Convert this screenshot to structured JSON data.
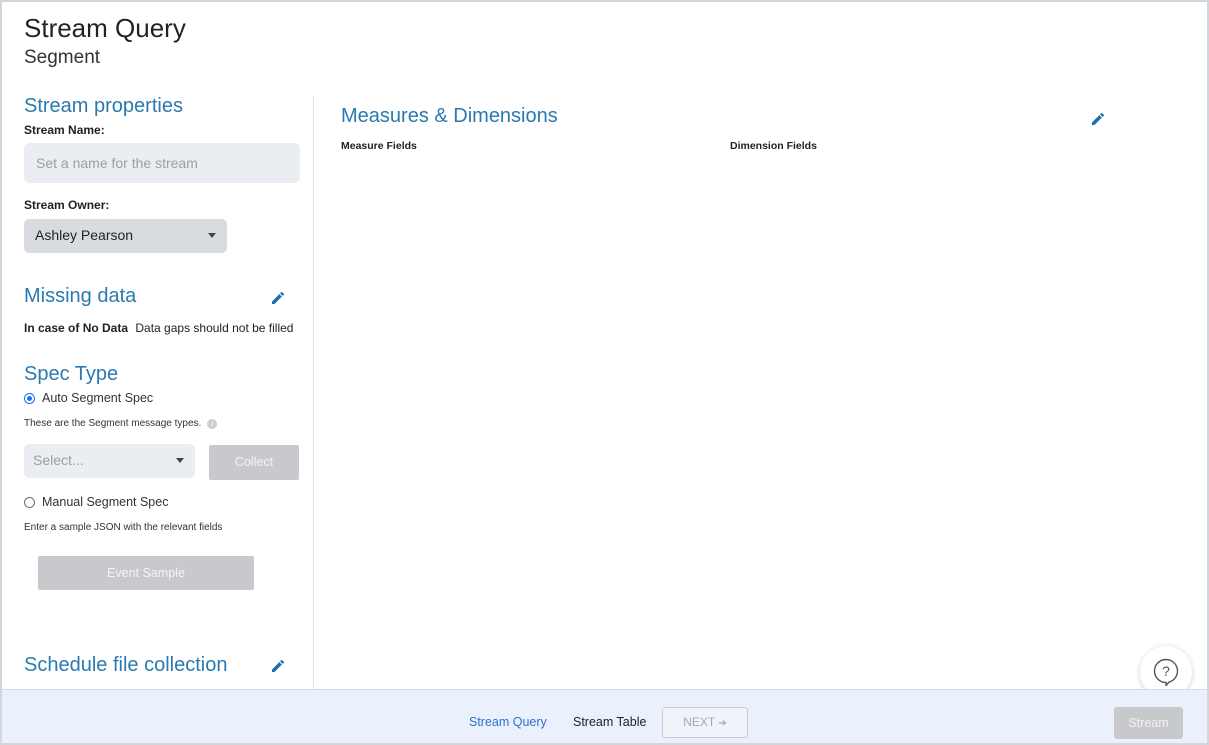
{
  "header": {
    "title": "Stream Query",
    "subtitle": "Segment"
  },
  "stream_properties": {
    "title": "Stream properties",
    "name_label": "Stream Name:",
    "name_placeholder": "Set a name for the stream",
    "name_value": "",
    "owner_label": "Stream Owner:",
    "owner_value": "Ashley Pearson"
  },
  "missing_data": {
    "title": "Missing data",
    "case_label": "In case of No Data",
    "case_value": "Data gaps should not be filled"
  },
  "spec_type": {
    "title": "Spec Type",
    "auto_label": "Auto Segment Spec",
    "auto_checked": true,
    "auto_note": "These are the Segment message types.",
    "select_placeholder": "Select...",
    "collect_label": "Collect",
    "manual_label": "Manual Segment Spec",
    "manual_checked": false,
    "manual_note": "Enter a sample JSON with the relevant fields",
    "event_sample_label": "Event Sample"
  },
  "schedule": {
    "title": "Schedule file collection"
  },
  "measures": {
    "title": "Measures & Dimensions",
    "measure_fields_label": "Measure Fields",
    "dimension_fields_label": "Dimension Fields"
  },
  "footer": {
    "step_query": "Stream Query",
    "step_table": "Stream Table",
    "next_label": "NEXT",
    "next_arrow": "➔",
    "stream_label": "Stream"
  },
  "colors": {
    "accent": "#2a7ab0",
    "link": "#2f6fcf",
    "footer_bg": "#eaf1fc",
    "disabled_button": "#c7c9cc"
  },
  "icons": {
    "edit": "pencil-icon",
    "dropdown": "caret-down-icon",
    "info": "info-icon",
    "help": "question-bubble-icon"
  }
}
